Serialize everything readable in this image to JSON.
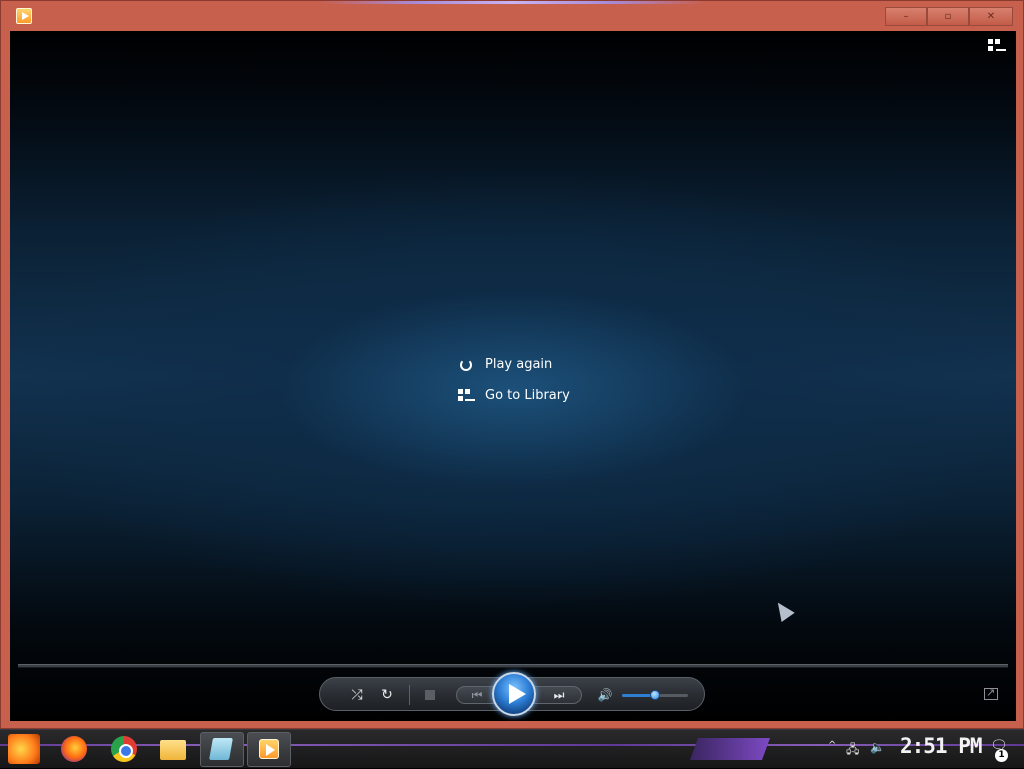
{
  "window": {
    "minimize_label": "–",
    "maximize_label": "▫",
    "close_label": "✕"
  },
  "player": {
    "menu": {
      "play_again": "Play again",
      "go_to_library": "Go to Library"
    },
    "controls": {
      "shuffle_icon": "⤮",
      "repeat_icon": "↻",
      "previous_icon": "⏮",
      "next_icon": "⏭",
      "volume_icon": "🔊",
      "volume_level": 0.5
    }
  },
  "taskbar": {
    "clock": "2:51 PM",
    "notification_count": "1",
    "tray_chevron": "^",
    "network_icon": "🖧",
    "speaker_icon": "🔈",
    "action_center_icon": "🗨"
  }
}
